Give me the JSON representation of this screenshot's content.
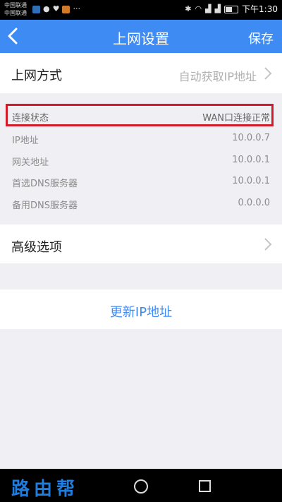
{
  "status_bar": {
    "carrier_1": "中国联通",
    "carrier_2": "中国联通",
    "time": "下午1:30",
    "dots": "···"
  },
  "header": {
    "title": "上网设置",
    "save_label": "保存"
  },
  "connection_mode": {
    "label": "上网方式",
    "value": "自动获取IP地址"
  },
  "wan_info": {
    "status": {
      "label": "连接状态",
      "value": "WAN口连接正常"
    },
    "ip": {
      "label": "IP地址",
      "value": "10.0.0.7"
    },
    "gateway": {
      "label": "网关地址",
      "value": "10.0.0.1"
    },
    "dns_primary": {
      "label": "首选DNS服务器",
      "value": "10.0.0.1"
    },
    "dns_secondary": {
      "label": "备用DNS服务器",
      "value": "0.0.0.0"
    }
  },
  "advanced": {
    "label": "高级选项"
  },
  "renew": {
    "label": "更新IP地址"
  },
  "watermark": "路由帮",
  "colors": {
    "accent": "#3f8bf4",
    "highlight": "#d11a2a",
    "background": "#efeff4"
  }
}
